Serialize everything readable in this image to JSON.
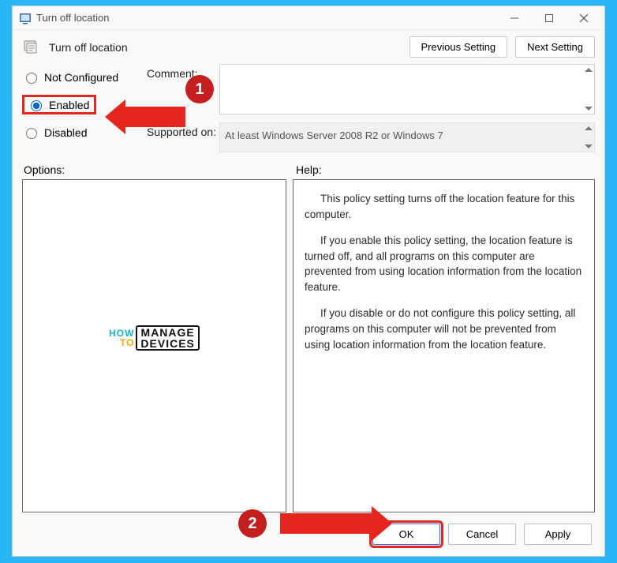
{
  "titlebar": {
    "title": "Turn off location"
  },
  "header": {
    "title": "Turn off location",
    "prev_label": "Previous Setting",
    "next_label": "Next Setting"
  },
  "state": {
    "not_configured_label": "Not Configured",
    "enabled_label": "Enabled",
    "disabled_label": "Disabled",
    "selected": "enabled",
    "comment_label": "Comment:",
    "comment_value": "",
    "supported_label": "Supported on:",
    "supported_value": "At least Windows Server 2008 R2 or Windows 7"
  },
  "labels": {
    "options": "Options:",
    "help": "Help:"
  },
  "help": {
    "p1": "This policy setting turns off the location feature for this computer.",
    "p2": "If you enable this policy setting, the location feature is turned off, and all programs on this computer are prevented from using location information from the location feature.",
    "p3": "If you disable or do not configure this policy setting, all programs on this computer will not be prevented from using location information from the location feature."
  },
  "watermark": {
    "how": "HOW",
    "to": "TO",
    "line1": "MANAGE",
    "line2": "DEVICES"
  },
  "buttons": {
    "ok": "OK",
    "cancel": "Cancel",
    "apply": "Apply"
  },
  "annotations": {
    "badge1": "1",
    "badge2": "2"
  }
}
